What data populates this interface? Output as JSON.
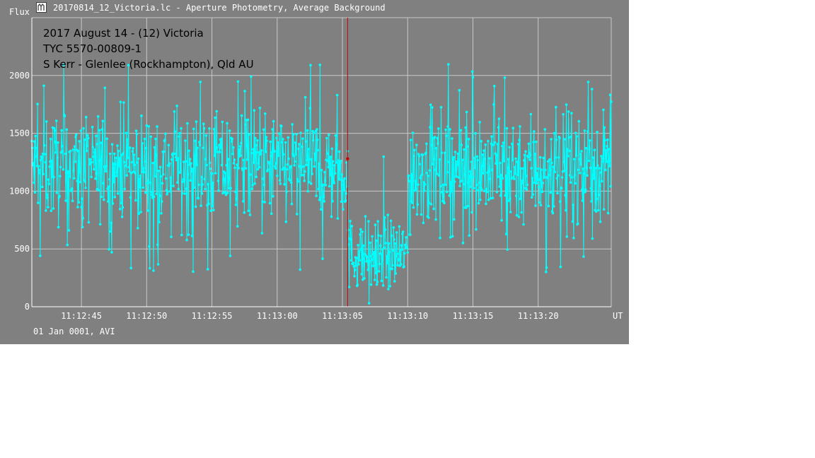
{
  "window": {
    "title": "20170814_12_Victoria.lc - Aperture Photometry, Average Background",
    "icon": "light-curve-app-icon"
  },
  "chart_data": {
    "type": "line",
    "title": "",
    "ylabel": "Flux",
    "xlabel": "UT",
    "ylim": [
      0,
      2500
    ],
    "yticks": [
      0,
      500,
      1000,
      1500,
      2000
    ],
    "x_tick_labels": [
      "11:12:45",
      "11:12:50",
      "11:12:55",
      "11:13:00",
      "11:13:05",
      "11:13:10",
      "11:13:15",
      "11:13:20"
    ],
    "x_range_seconds_after_11_12_40": [
      1.2,
      45.6
    ],
    "grid": true,
    "date_footer": "01 Jan 0001, AVI",
    "annotations": [
      "2017 August 14 - (12) Victoria",
      "TYC 5570-00809-1",
      "S Kerr - Glenlee (Rockhampton), Qld AU"
    ],
    "series": [
      {
        "color": "#00ffff",
        "marker": "dot",
        "description_levels": [
          {
            "from": "11:12:41.2",
            "to": "11:13:05.4",
            "mean": 1200,
            "noise": "±400"
          },
          {
            "from": "11:13:05.4",
            "to": "11:13:10.0",
            "mean": 450,
            "noise": "±200"
          },
          {
            "from": "11:13:10.0",
            "to": "11:13:25.6",
            "mean": 1200,
            "noise": "±400"
          }
        ]
      }
    ],
    "cursor": {
      "time": "11:13:05.4",
      "value": 1280,
      "color": "#cc0000"
    }
  },
  "colors": {
    "background": "#808080",
    "grid": "#c8c8c8",
    "series": "#00ffff",
    "cursor": "#cc0000"
  }
}
